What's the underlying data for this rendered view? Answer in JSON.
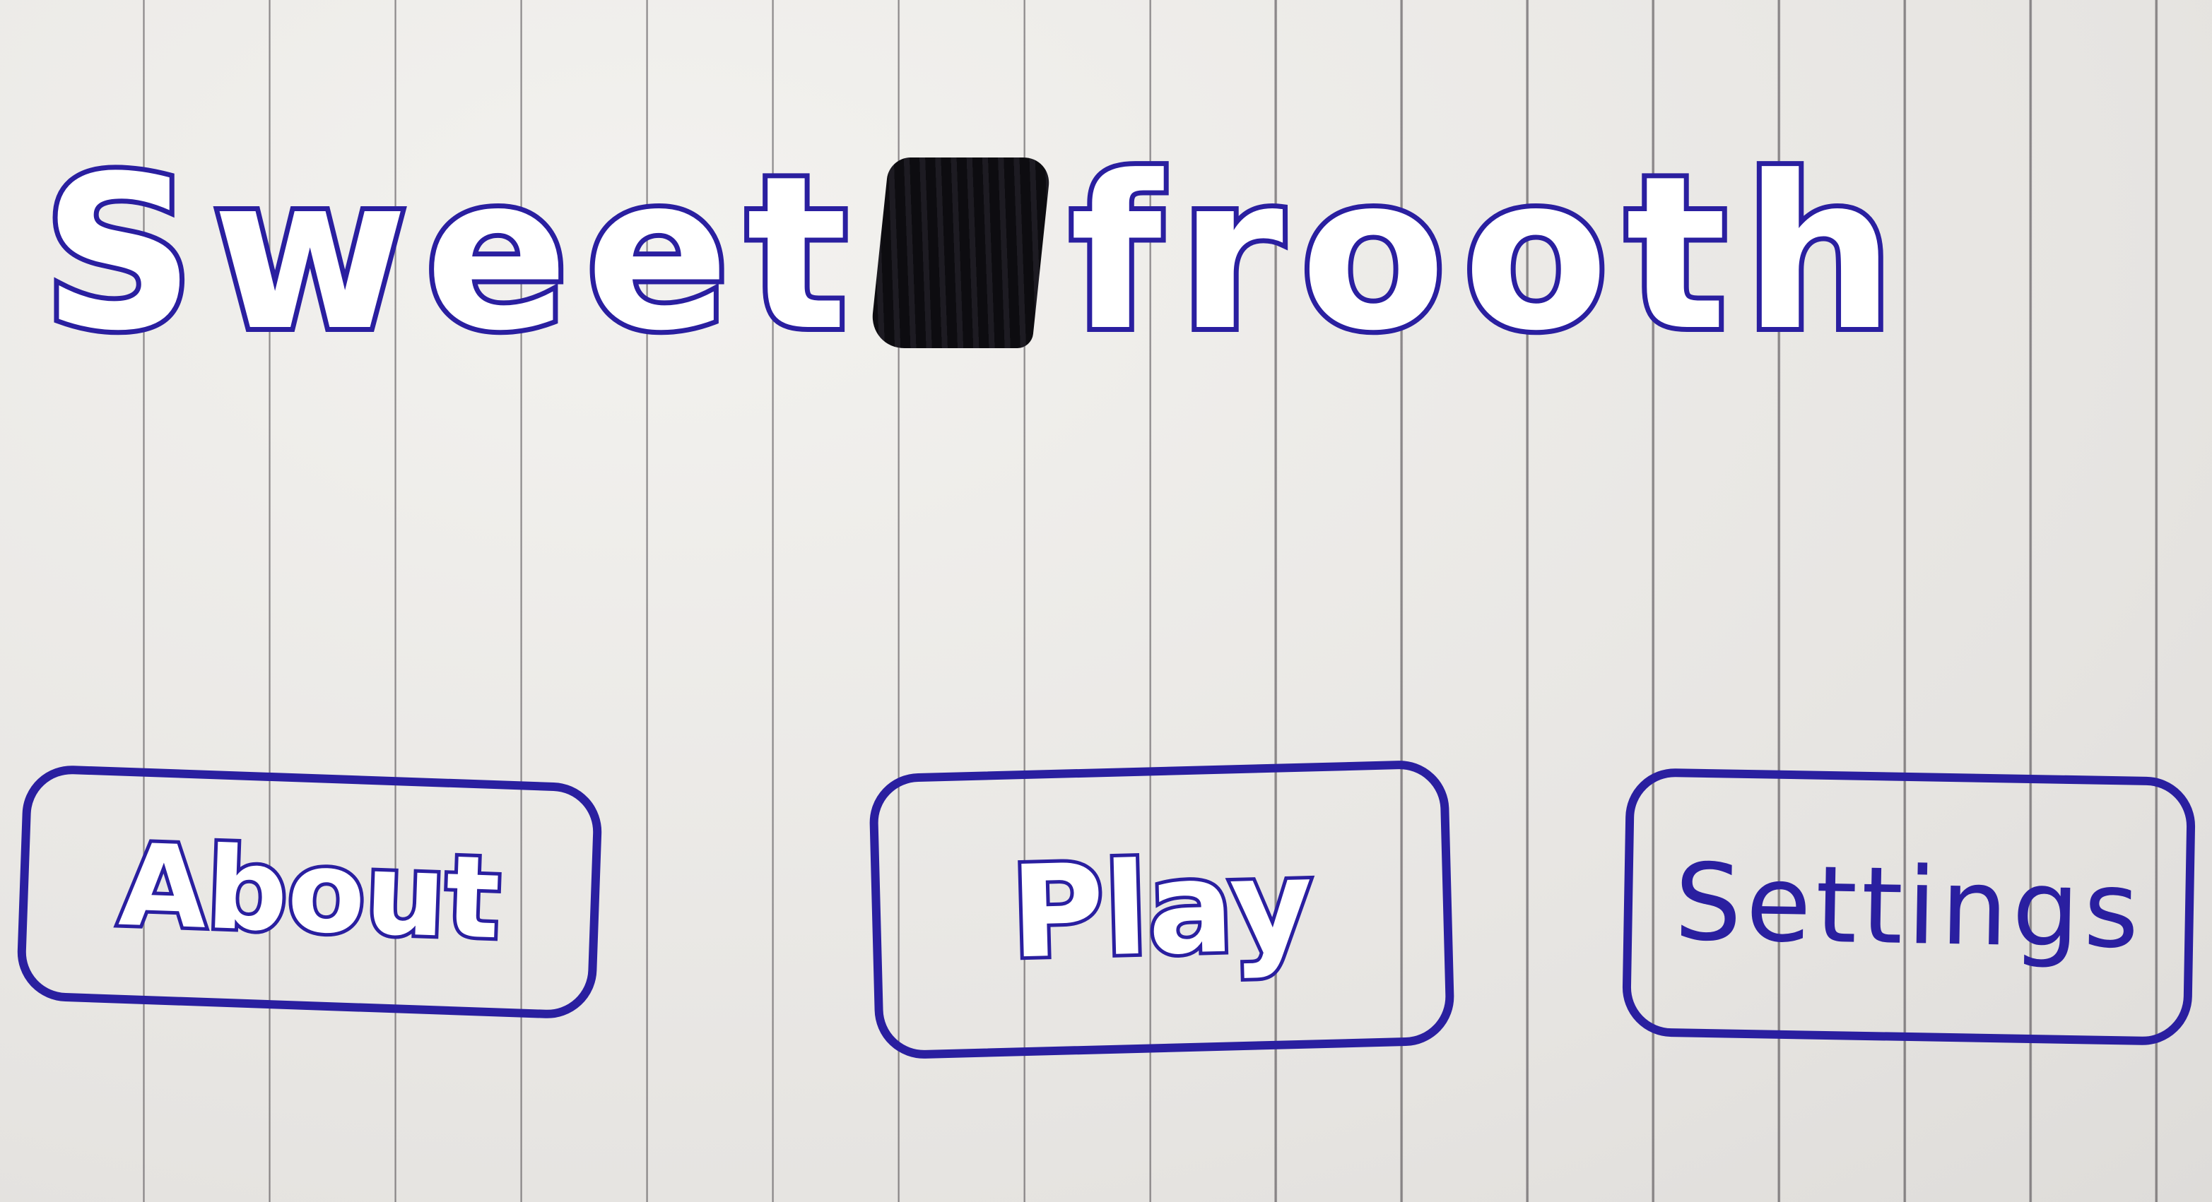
{
  "title": {
    "word1": "Sweet",
    "word2": "frooth"
  },
  "buttons": {
    "about": "About",
    "play": "Play",
    "settings": "Settings"
  },
  "colors": {
    "ink": "#2a1fa0",
    "scribble": "#0d0c10",
    "paper": "#eceae7",
    "rule_lines": "#3c373c"
  }
}
